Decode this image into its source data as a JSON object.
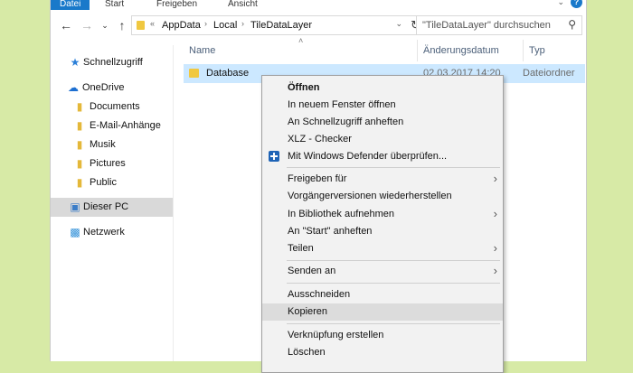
{
  "ribbon": {
    "tabs": [
      "Datei",
      "Start",
      "Freigeben",
      "Ansicht"
    ],
    "help_label": "?"
  },
  "address": {
    "segments": [
      "AppData",
      "Local",
      "TileDataLayer"
    ]
  },
  "search": {
    "placeholder": "\"TileDataLayer\" durchsuchen"
  },
  "sidebar": {
    "items": [
      {
        "label": "Schnellzugriff",
        "icon": "star-icon"
      },
      {
        "label": "OneDrive",
        "icon": "cloud-icon"
      },
      {
        "label": "Documents",
        "icon": "folder-icon"
      },
      {
        "label": "E-Mail-Anhänge",
        "icon": "folder-icon"
      },
      {
        "label": "Musik",
        "icon": "folder-icon"
      },
      {
        "label": "Pictures",
        "icon": "folder-icon"
      },
      {
        "label": "Public",
        "icon": "folder-icon"
      },
      {
        "label": "Dieser PC",
        "icon": "pc-icon"
      },
      {
        "label": "Netzwerk",
        "icon": "network-icon"
      }
    ]
  },
  "columns": {
    "name": "Name",
    "date": "Änderungsdatum",
    "type": "Typ"
  },
  "file": {
    "name": "Database",
    "date": "02.03.2017 14:20",
    "type": "Dateiordner"
  },
  "context_menu": {
    "items": [
      {
        "label": "Öffnen",
        "bold": true
      },
      {
        "label": "In neuem Fenster öffnen"
      },
      {
        "label": "An Schnellzugriff anheften"
      },
      {
        "label": "XLZ - Checker"
      },
      {
        "label": "Mit Windows Defender überprüfen...",
        "icon": "shield-icon"
      },
      {
        "label": "Freigeben für",
        "submenu": true
      },
      {
        "label": "Vorgängerversionen wiederherstellen"
      },
      {
        "label": "In Bibliothek aufnehmen",
        "submenu": true
      },
      {
        "label": "An \"Start\" anheften"
      },
      {
        "label": "Teilen",
        "submenu": true
      },
      {
        "label": "Senden an",
        "submenu": true
      },
      {
        "label": "Ausschneiden"
      },
      {
        "label": "Kopieren",
        "hovered": true
      },
      {
        "label": "Verknüpfung erstellen"
      },
      {
        "label": "Löschen"
      }
    ]
  },
  "colors": {
    "accent": "#1979ca",
    "selection": "#cce8ff",
    "hover": "#dcdcdc",
    "background": "#d7eaa6"
  }
}
